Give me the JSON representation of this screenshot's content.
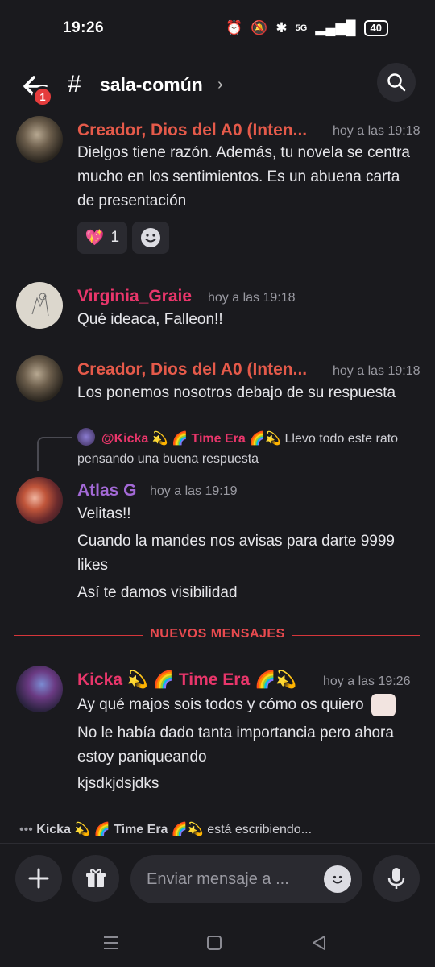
{
  "status_bar": {
    "time": "19:26",
    "network": "5G",
    "battery": "40"
  },
  "header": {
    "unread_badge": "1",
    "channel_name": "sala-común",
    "hash_symbol": "#"
  },
  "messages": [
    {
      "author": "Creador, Dios del A0 (Inten...",
      "author_color": "#e55a4a",
      "timestamp": "hoy a las 19:18",
      "lines": [
        "Dielgos tiene razón. Además, tu novela se centra mucho en los sentimientos. Es un abuena carta de presentación"
      ],
      "reaction": {
        "emoji": "💖",
        "count": "1"
      }
    },
    {
      "author": "Virginia_Graie",
      "author_color": "#e9366b",
      "timestamp": "hoy a las 19:18",
      "lines": [
        "Qué ideaca, Falleon!!"
      ]
    },
    {
      "author": "Creador, Dios del A0 (Inten...",
      "author_color": "#e55a4a",
      "timestamp": "hoy a las 19:18",
      "lines": [
        "Los ponemos nosotros debajo de su respuesta"
      ]
    },
    {
      "reply": {
        "author": "@Kicka 💫 🌈 Time Era 🌈💫",
        "text": "Llevo todo este rato pensando una buena respuesta"
      },
      "author": "Atlas G",
      "author_color": "#a369d6",
      "timestamp": "hoy a las 19:19",
      "lines": [
        "Velitas!!",
        "Cuando la mandes nos avisas para darte 9999 likes",
        "Así te damos visibilidad"
      ]
    },
    {
      "author": "Kicka 💫 🌈 Time Era 🌈💫",
      "author_color": "#e9366b",
      "timestamp": "hoy a las 19:26",
      "lines": [
        "Ay qué majos sois todos y cómo os quiero",
        "No le había dado tanta importancia pero ahora estoy paniqueando",
        "kjsdkjdsjdks"
      ]
    }
  ],
  "new_messages_divider": "NUEVOS MENSAJES",
  "typing": {
    "name": "Kicka 💫 🌈 Time Era 🌈💫",
    "suffix": "está escribiendo..."
  },
  "composer": {
    "placeholder": "Enviar mensaje a ..."
  },
  "icons": {
    "back": "back-arrow-icon",
    "search": "search-icon",
    "add": "plus-icon",
    "gift": "gift-icon",
    "emoji": "emoji-icon",
    "mic": "microphone-icon"
  }
}
